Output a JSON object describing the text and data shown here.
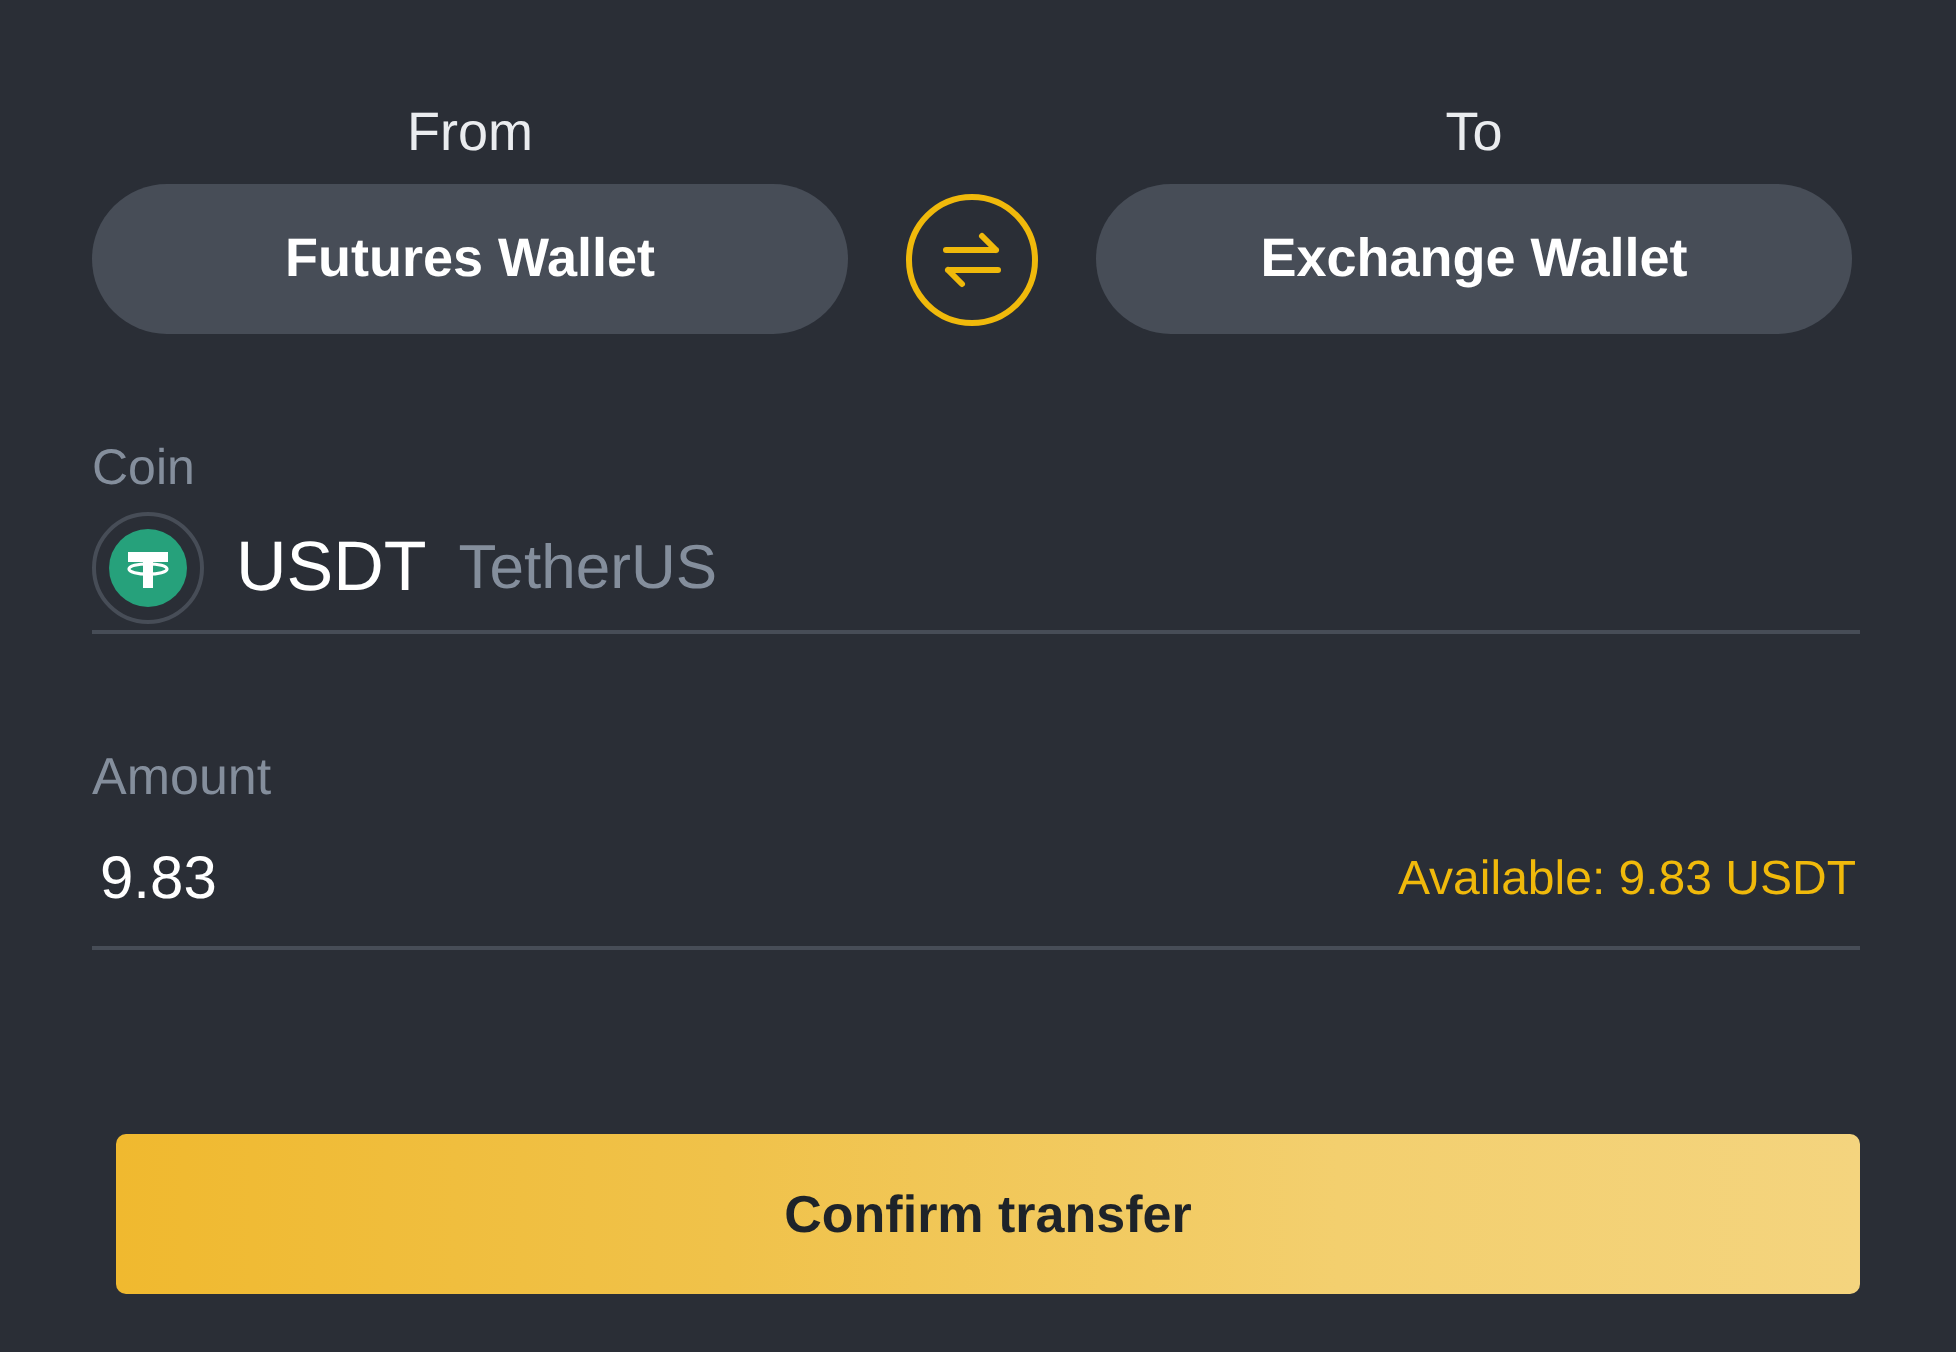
{
  "from": {
    "label": "From",
    "wallet": "Futures Wallet"
  },
  "to": {
    "label": "To",
    "wallet": "Exchange Wallet"
  },
  "coin": {
    "label": "Coin",
    "symbol": "USDT",
    "name": "TetherUS"
  },
  "amount": {
    "label": "Amount",
    "value": "9.83",
    "available": "Available: 9.83 USDT"
  },
  "confirm_button": "Confirm transfer"
}
